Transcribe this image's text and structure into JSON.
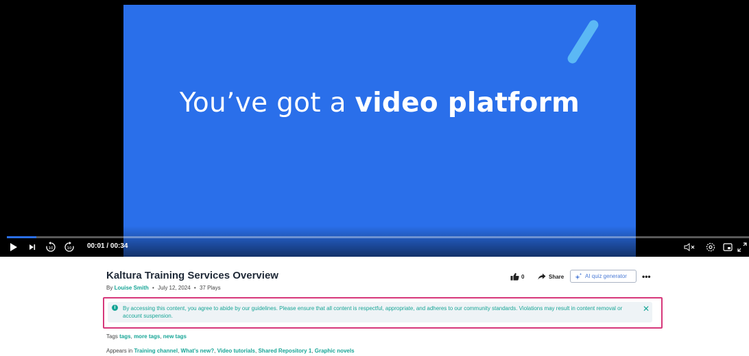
{
  "video": {
    "headline_regular": "You’ve got a",
    "headline_bold": "video platform",
    "current_time": "00:01",
    "duration": "00:34",
    "time_display": "00:01 / 00:34",
    "progress": 0.04
  },
  "player_controls": {
    "play": "play-icon",
    "next": "skip-next-icon",
    "rewind": "rewind-10-icon",
    "forward": "forward-10-icon",
    "mute": "volume-mute-icon",
    "settings": "gear-icon",
    "pip": "picture-in-picture-icon",
    "fullscreen": "fullscreen-icon"
  },
  "entry": {
    "title": "Kaltura Training Services Overview",
    "by_prefix": "By",
    "author": "Louise Smith",
    "date": "July 12, 2024",
    "plays": "37 Plays"
  },
  "actions": {
    "like_count": "0",
    "share_label": "Share",
    "quiz_label": "AI quiz generator",
    "more_label": "•••"
  },
  "notice": {
    "text": "By accessing this content, you agree to abide by our guidelines. Please ensure that all content is respectful, appropriate, and adheres to our community standards. Violations may result in content removal or account suspension.",
    "icon": "i",
    "close": "✕"
  },
  "tags": {
    "label": "Tags",
    "items": [
      "tags",
      "more tags",
      "new tags"
    ]
  },
  "appears_in": {
    "label": "Appears in",
    "items": [
      "Training channel",
      "What's new?",
      "Video tutorials",
      "Shared Repository 1",
      "Graphic novels"
    ]
  },
  "colors": {
    "accent": "#17a596",
    "video_bg": "#2a6fea",
    "highlight_border": "#d6377a"
  }
}
